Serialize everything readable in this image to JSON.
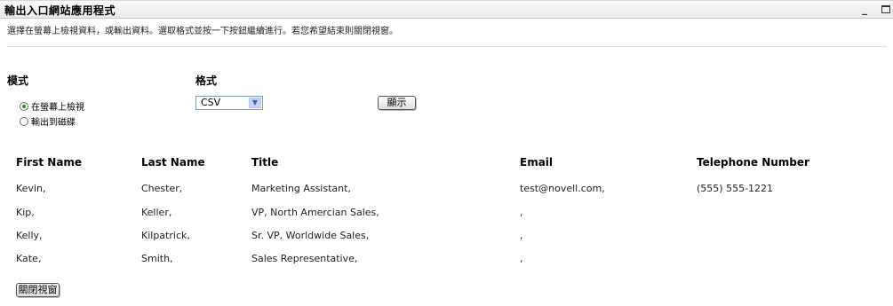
{
  "window": {
    "title": "輸出入口網站應用程式",
    "minimize_label": "_"
  },
  "instructions": "選擇在螢幕上檢視資料，或輸出資料。選取格式並按一下按鈕繼續進行。若您希望結束則關閉視窗。",
  "mode": {
    "label": "模式",
    "options": [
      {
        "label": "在螢幕上檢視",
        "selected": true
      },
      {
        "label": "輸出到磁碟",
        "selected": false
      }
    ]
  },
  "format": {
    "label": "格式",
    "selected": "CSV"
  },
  "buttons": {
    "show": "顯示",
    "close": "關閉視窗"
  },
  "table": {
    "columns": [
      "First Name",
      "Last Name",
      "Title",
      "Email",
      "Telephone Number"
    ],
    "rows": [
      [
        "Kevin,",
        "Chester,",
        "Marketing Assistant,",
        "test@novell.com,",
        "(555) 555-1221"
      ],
      [
        "Kip,",
        "Keller,",
        "VP, North Amercian Sales,",
        ",",
        ""
      ],
      [
        "Kelly,",
        "Kilpatrick,",
        "Sr. VP, Worldwide Sales,",
        ",",
        ""
      ],
      [
        "Kate,",
        "Smith,",
        "Sales Representative,",
        ",",
        ""
      ]
    ]
  }
}
